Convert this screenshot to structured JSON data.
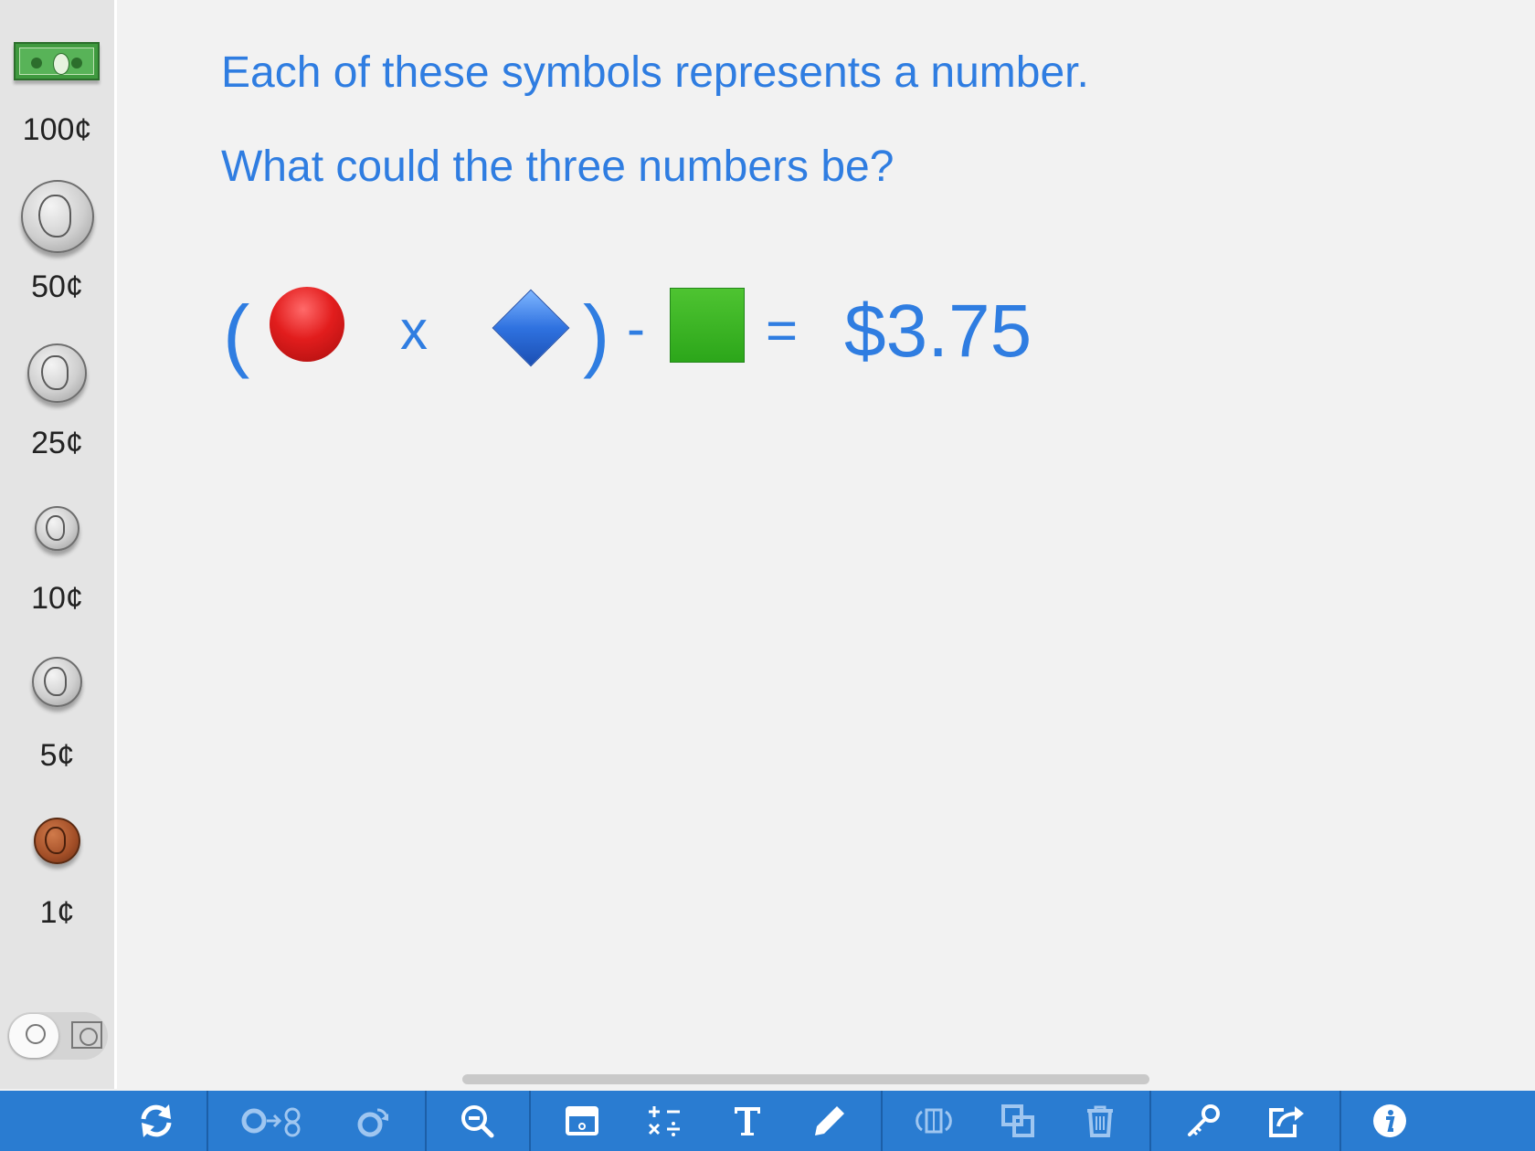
{
  "sidebar": {
    "items": [
      {
        "label": "100¢",
        "icon": "dollar-bill-icon"
      },
      {
        "label": "50¢",
        "icon": "half-dollar-coin-icon"
      },
      {
        "label": "25¢",
        "icon": "quarter-coin-icon"
      },
      {
        "label": "10¢",
        "icon": "dime-coin-icon"
      },
      {
        "label": "5¢",
        "icon": "nickel-coin-icon"
      },
      {
        "label": "1¢",
        "icon": "penny-coin-icon"
      }
    ],
    "toggle": {
      "selected": "coins"
    }
  },
  "main": {
    "prompt_line1": "Each of these symbols represents a number.",
    "prompt_line2": "What could the three numbers be?",
    "equation": {
      "open_paren": "(",
      "times": "x",
      "close_paren": ")",
      "minus": "-",
      "equals": "=",
      "result": "$3.75",
      "symbols": [
        "red-circle",
        "blue-diamond",
        "green-square"
      ]
    }
  },
  "colors": {
    "accent_text": "#2f7de1",
    "toolbar": "#2a7cd1",
    "red": "#e21d1d",
    "blue": "#2f72e0",
    "green": "#2ca61a"
  },
  "toolbar": {
    "buttons": [
      "refresh-icon",
      "exchange-coins-icon",
      "flip-coin-icon",
      "zoom-out-icon",
      "screen-icon",
      "math-operators-icon",
      "text-icon",
      "pencil-icon",
      "rotate-icon",
      "duplicate-icon",
      "trash-icon",
      "key-icon",
      "share-icon",
      "info-icon"
    ]
  }
}
